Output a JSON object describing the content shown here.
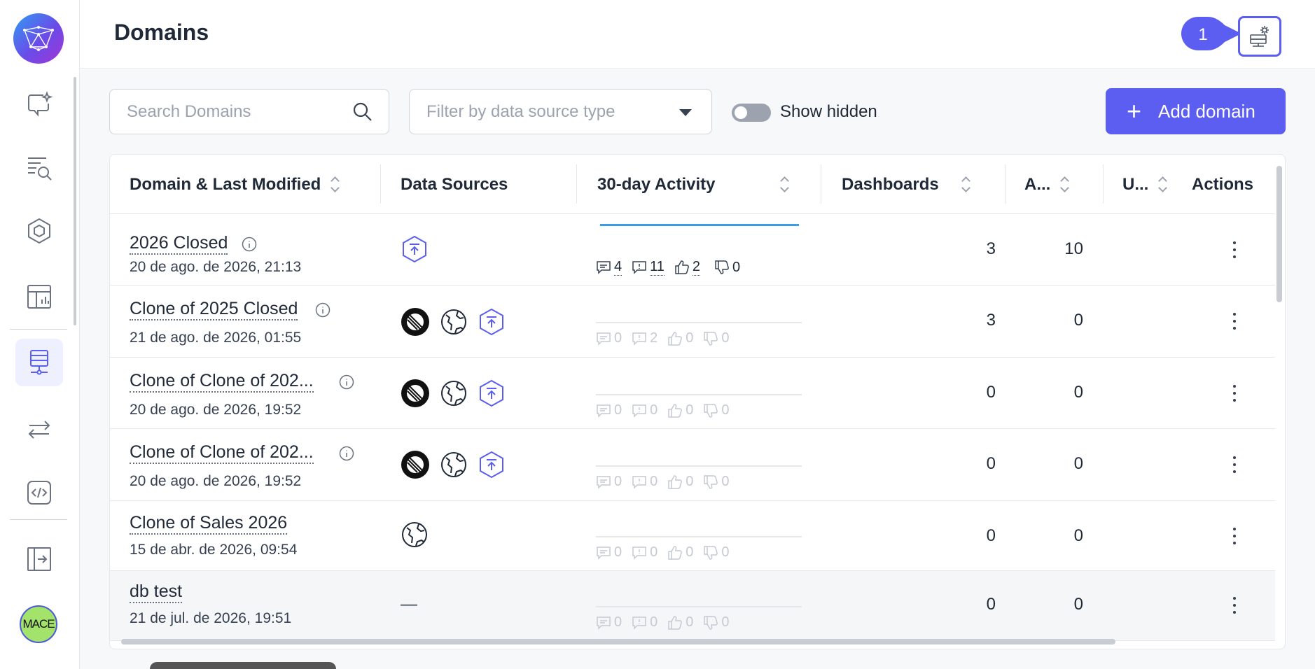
{
  "page": {
    "title": "Domains"
  },
  "header": {
    "badge_number": "1"
  },
  "toolbar": {
    "search_placeholder": "Search Domains",
    "filter_placeholder": "Filter by data source type",
    "show_hidden_label": "Show hidden",
    "add_label": "Add domain"
  },
  "avatar": {
    "initials": "MACE"
  },
  "table": {
    "columns": {
      "domain": "Domain & Last Modified",
      "sources": "Data Sources",
      "activity": "30-day Activity",
      "dashboards": "Dashboards",
      "a": "A...",
      "u": "U...",
      "actions": "Actions"
    },
    "rows": [
      {
        "name": "2026 Closed",
        "date": "20 de ago. de 2026, 21:13",
        "comments": "4",
        "questions": "11",
        "likes": "2",
        "dislikes": "0",
        "dashboards": "3",
        "a": "10"
      },
      {
        "name": "Clone of 2025 Closed",
        "date": "21 de ago. de 2026, 01:55",
        "comments": "0",
        "questions": "2",
        "likes": "0",
        "dislikes": "0",
        "dashboards": "3",
        "a": "0"
      },
      {
        "name": "Clone of Clone of 202...",
        "date": "20 de ago. de 2026, 19:52",
        "comments": "0",
        "questions": "0",
        "likes": "0",
        "dislikes": "0",
        "dashboards": "0",
        "a": "0"
      },
      {
        "name": "Clone of Clone of 202...",
        "date": "20 de ago. de 2026, 19:52",
        "comments": "0",
        "questions": "0",
        "likes": "0",
        "dislikes": "0",
        "dashboards": "0",
        "a": "0"
      },
      {
        "name": "Clone of Sales 2026",
        "date": "15 de abr. de 2026, 09:54",
        "comments": "0",
        "questions": "0",
        "likes": "0",
        "dislikes": "0",
        "dashboards": "0",
        "a": "0"
      },
      {
        "name": "db test",
        "date": "21 de jul. de 2026, 19:51",
        "sources_empty": "—",
        "comments": "0",
        "questions": "0",
        "likes": "0",
        "dislikes": "0",
        "dashboards": "0",
        "a": "0"
      }
    ]
  },
  "colors": {
    "accent": "#5b5ef0",
    "activity_line": "#3a9be6"
  }
}
